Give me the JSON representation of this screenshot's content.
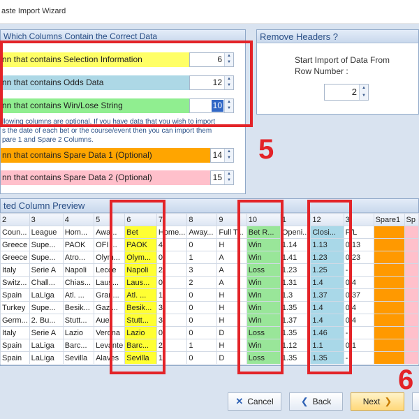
{
  "window": {
    "title": "aste Import Wizard"
  },
  "columns_group": {
    "title": " Which Columns Contain the Correct Data",
    "fields": [
      {
        "label": "nn that contains Selection Information",
        "value": "6",
        "color": "#ffff66"
      },
      {
        "label": "nn that contains Odds Data",
        "value": "12",
        "color": "#add8e6"
      },
      {
        "label": "nn that contains Win/Lose String",
        "value": "10",
        "color": "#90ee90"
      },
      {
        "label": "nn that contains Spare Data 1 (Optional)",
        "value": "14",
        "color": "#ffa500"
      },
      {
        "label": "nn that contains Spare Data 2 (Optional)",
        "value": "15",
        "color": "#ffc0cb"
      }
    ],
    "note_line1": "llowing columns are optional.  If you have data that you wish to import",
    "note_line2": "s the date of each bet or the course/event then you can import them",
    "note_line3": "pare 1 and Spare 2 Columns."
  },
  "remove_headers": {
    "title": "Remove Headers ?",
    "label_line1": "Start Import of Data From",
    "label_line2": "Row Number :",
    "value": "2"
  },
  "preview": {
    "title": "ted Column Preview",
    "headers": [
      "2",
      "3",
      "4",
      "5",
      "6",
      "7",
      "8",
      "9",
      "10",
      "1",
      "12",
      "3",
      "Spare1",
      "Sp"
    ],
    "rows": [
      [
        "Coun...",
        "League",
        "Hom...",
        "Awa...",
        "Bet",
        "Home...",
        "Away...",
        "Full T...",
        "Bet R...",
        "Openi...",
        "Closi...",
        "P/L",
        "",
        ""
      ],
      [
        "Greece",
        "Supe...",
        "PAOK",
        "OFI ...",
        "PAOK",
        "4",
        "0",
        "H",
        "Win",
        "1.14",
        "1.13",
        "0.13",
        "",
        ""
      ],
      [
        "Greece",
        "Supe...",
        "Atro...",
        "Olym...",
        "Olym...",
        "0",
        "1",
        "A",
        "Win",
        "1.41",
        "1.23",
        "0.23",
        "",
        ""
      ],
      [
        "Italy",
        "Serie A",
        "Napoli",
        "Lecce",
        "Napoli",
        "2",
        "3",
        "A",
        "Loss",
        "1.23",
        "1.25",
        "-",
        "",
        ""
      ],
      [
        "Switz...",
        "Chall...",
        "Chias...",
        "Laus...",
        "Laus...",
        "0",
        "2",
        "A",
        "Win",
        "1.31",
        "1.4",
        "0.4",
        "",
        ""
      ],
      [
        "Spain",
        "LaLiga",
        "Atl. ...",
        "Gran...",
        "Atl. ...",
        "1",
        "0",
        "H",
        "Win",
        "1.3",
        "1.37",
        "0.37",
        "",
        ""
      ],
      [
        "Turkey",
        "Supe...",
        "Besik...",
        "Gazi...",
        "Besik...",
        "3",
        "0",
        "H",
        "Win",
        "1.35",
        "1.4",
        "0.4",
        "",
        ""
      ],
      [
        "Germ...",
        "2. Bu...",
        "Stutt...",
        "Aue",
        "Stutt...",
        "3",
        "0",
        "H",
        "Win",
        "1.37",
        "1.4",
        "0.4",
        "",
        ""
      ],
      [
        "Italy",
        "Serie A",
        "Lazio",
        "Verona",
        "Lazio",
        "0",
        "0",
        "D",
        "Loss",
        "1.35",
        "1.46",
        "-",
        "",
        ""
      ],
      [
        "Spain",
        "LaLiga",
        "Barc...",
        "Levante",
        "Barc...",
        "2",
        "1",
        "H",
        "Win",
        "1.12",
        "1.1",
        "0.1",
        "",
        ""
      ],
      [
        "Spain",
        "LaLiga",
        "Sevilla",
        "Alaves",
        "Sevilla",
        "1",
        "0",
        "D",
        "Loss",
        "1.35",
        "1.35",
        "-",
        "",
        ""
      ]
    ]
  },
  "annotations": {
    "five": "5",
    "six": "6"
  },
  "buttons": {
    "cancel": "Cancel",
    "back": "Back",
    "next": "Next"
  },
  "icons": {
    "cancel": "cancel-x-icon",
    "back": "back-arrow-icon",
    "next": "next-arrow-icon"
  },
  "colors": {
    "annotation": "#e32328",
    "header_text": "#2a4f86"
  }
}
